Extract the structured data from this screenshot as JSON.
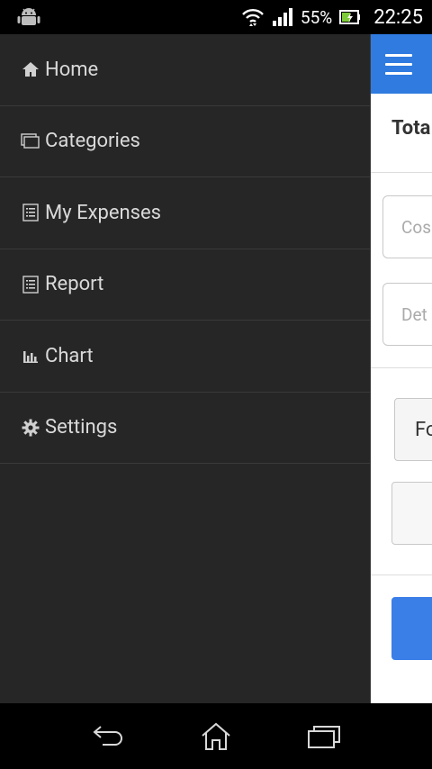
{
  "status_bar": {
    "battery": "55%",
    "time": "22:25",
    "icons": [
      "android-icon",
      "wifi-icon",
      "signal-icon",
      "battery-icon"
    ]
  },
  "drawer": {
    "items": [
      {
        "label": "Home",
        "icon": "home-icon"
      },
      {
        "label": "Categories",
        "icon": "categories-icon"
      },
      {
        "label": "My Expenses",
        "icon": "list-icon"
      },
      {
        "label": "Report",
        "icon": "list-icon"
      },
      {
        "label": "Chart",
        "icon": "bar-chart-icon"
      },
      {
        "label": "Settings",
        "icon": "gear-icon"
      }
    ]
  },
  "content": {
    "total_label": "Tota",
    "cost_placeholder": "Cos",
    "details_placeholder": "Det",
    "button_text": "Fo",
    "accent_color": "#2f7be0"
  },
  "nav_bar": {
    "icons": [
      "back-icon",
      "home-nav-icon",
      "recent-apps-icon"
    ]
  }
}
